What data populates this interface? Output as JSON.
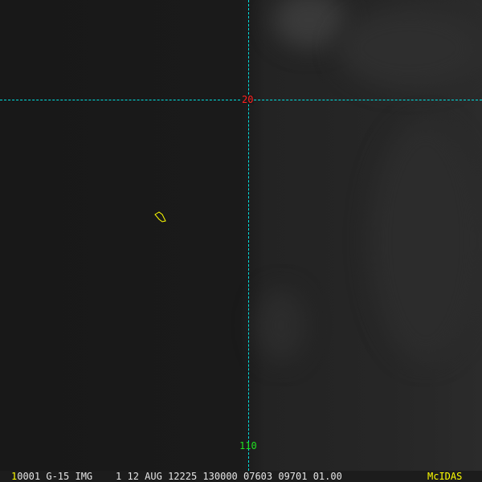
{
  "map": {
    "latitude_label": "20",
    "longitude_label": "110"
  },
  "status_bar": {
    "frame_number": "1",
    "info": "0001 G-15 IMG    1 12 AUG 12225 130000 07603 09701 01.00",
    "brand": "McIDAS"
  },
  "colors": {
    "gridline": "#00e0e0",
    "lat_label": "#ff2020",
    "lon_label": "#20e020",
    "marker": "#ffff00"
  }
}
